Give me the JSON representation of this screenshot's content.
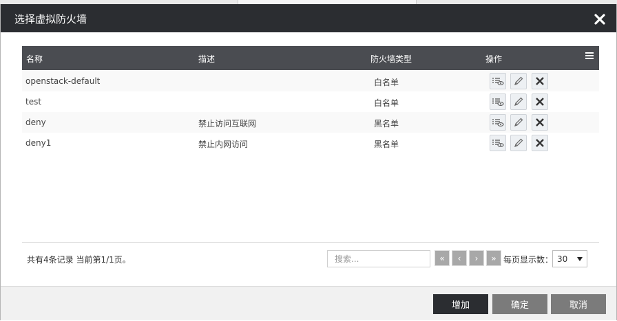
{
  "dialog": {
    "title": "选择虚拟防火墙"
  },
  "table": {
    "headers": {
      "name": "名称",
      "desc": "描述",
      "type": "防火墙类型",
      "ops": "操作"
    },
    "rows": [
      {
        "name": "openstack-default",
        "desc": "",
        "type": "白名单"
      },
      {
        "name": "test",
        "desc": "",
        "type": "白名单"
      },
      {
        "name": "deny",
        "desc": "禁止访问互联网",
        "type": "黑名单"
      },
      {
        "name": "deny1",
        "desc": "禁止内网访问",
        "type": "黑名单"
      }
    ]
  },
  "pagination": {
    "records_text": "共有4条记录 当前第1/1页。",
    "search_placeholder": "搜索...",
    "first": "«",
    "prev": "‹",
    "next": "›",
    "last": "»",
    "per_page_label": "每页显示数：",
    "per_page_value": "30"
  },
  "footer": {
    "add": "增加",
    "confirm": "确定",
    "cancel": "取消"
  },
  "colors": {
    "titlebar": "#2b2d31",
    "table_header": "#4a4c51",
    "add_button": "#2b2d31",
    "confirm_button": "#7b7b7b",
    "cancel_button": "#7b7b7b"
  },
  "icons": {
    "close": "close-icon",
    "menu": "menu-icon",
    "view": "view-list-icon",
    "edit": "pencil-icon",
    "delete": "x-icon"
  }
}
